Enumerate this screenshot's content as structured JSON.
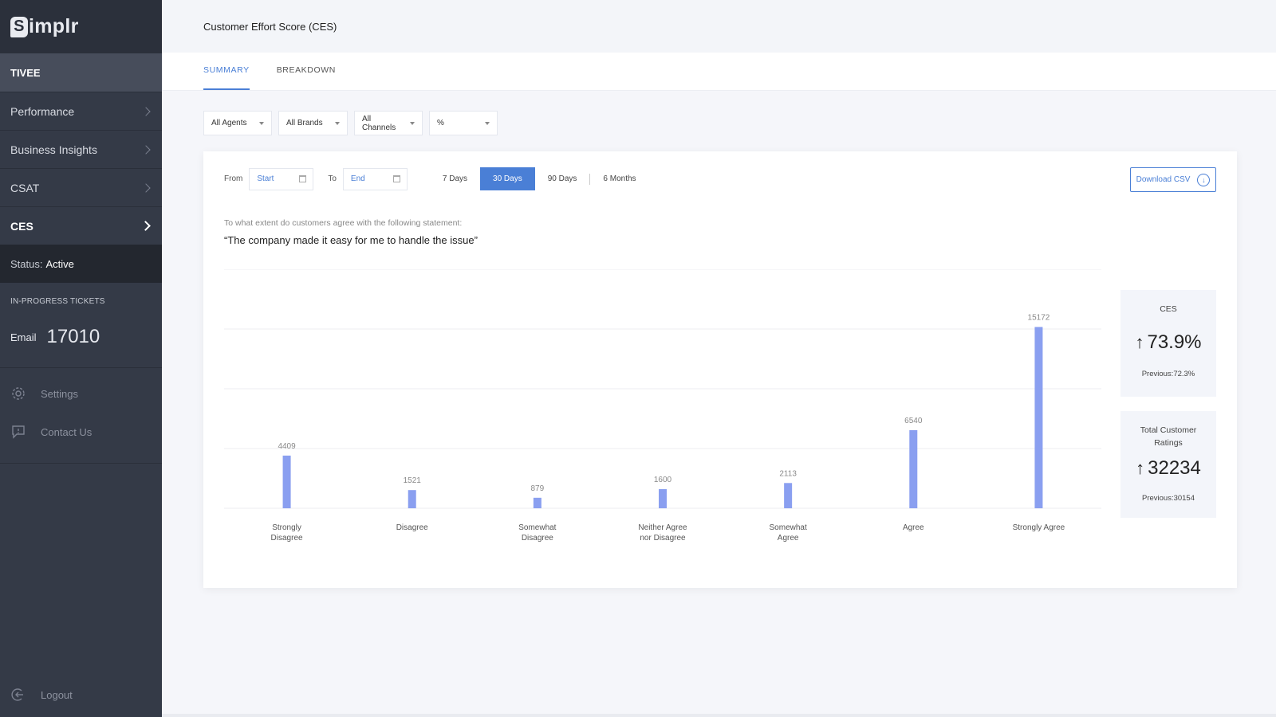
{
  "app": {
    "logo_text": "implr",
    "logo_letter": "S"
  },
  "sidebar": {
    "org": "TIVEE",
    "items": [
      {
        "label": "Performance"
      },
      {
        "label": "Business Insights"
      },
      {
        "label": "CSAT"
      },
      {
        "label": "CES"
      }
    ],
    "status_label": "Status:",
    "status_value": "Active",
    "in_progress_label": "IN-PROGRESS TICKETS",
    "email_label": "Email",
    "email_count": "17010",
    "settings": "Settings",
    "contact": "Contact Us",
    "logout": "Logout"
  },
  "header": {
    "title": "Customer Effort Score (CES)"
  },
  "tabs": [
    {
      "label": "SUMMARY"
    },
    {
      "label": "BREAKDOWN"
    }
  ],
  "filters": {
    "agents": "All Agents",
    "brands": "All Brands",
    "channels": "All Channels",
    "unit": "%"
  },
  "date": {
    "from_label": "From",
    "start_placeholder": "Start",
    "to_label": "To",
    "end_placeholder": "End",
    "ranges": [
      "7 Days",
      "30 Days",
      "90 Days",
      "6 Months"
    ],
    "active_range": "30 Days"
  },
  "download_label": "Download CSV",
  "question": {
    "prompt": "To what extent do customers agree with the following statement:",
    "statement": "“The company made it easy for me to handle the issue”"
  },
  "kpis": {
    "ces": {
      "title": "CES",
      "value": "73.9%",
      "previous": "Previous:72.3%"
    },
    "ratings": {
      "title": "Total Customer Ratings",
      "value": "32234",
      "previous": "Previous:30154"
    }
  },
  "chart_data": {
    "type": "bar",
    "categories": [
      "Strongly Disagree",
      "Disagree",
      "Somewhat Disagree",
      "Neither Agree nor Disagree",
      "Somewhat Agree",
      "Agree",
      "Strongly Agree"
    ],
    "category_lines": [
      [
        "Strongly",
        "Disagree"
      ],
      [
        "Disagree"
      ],
      [
        "Somewhat",
        "Disagree"
      ],
      [
        "Neither Agree",
        "nor Disagree"
      ],
      [
        "Somewhat",
        "Agree"
      ],
      [
        "Agree"
      ],
      [
        "Strongly Agree"
      ]
    ],
    "values": [
      4409,
      1521,
      879,
      1600,
      2113,
      6540,
      15172
    ],
    "ylim": [
      0,
      20000
    ],
    "grid": true,
    "bar_color": "#8a9ff0"
  }
}
